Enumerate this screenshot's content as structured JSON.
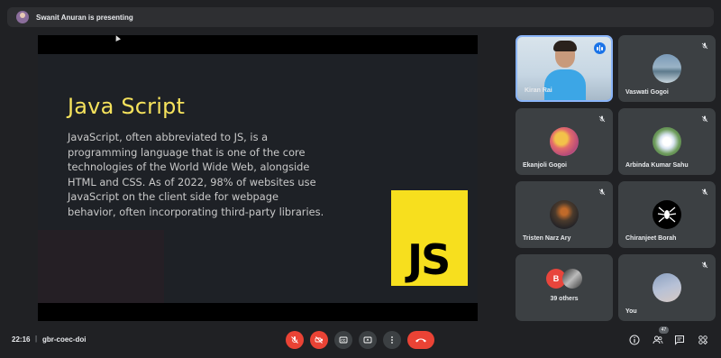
{
  "presenter": {
    "text": "Swanit Anuran is presenting"
  },
  "slide": {
    "title": "Java Script",
    "body": "JavaScript, often abbreviated to JS, is a programming language that is one of the core technologies of the World Wide Web, alongside HTML and CSS. As of 2022, 98% of websites use JavaScript on the client side for webpage behavior, often incorporating third-party libraries.",
    "logo_text": "JS",
    "colors": {
      "title": "#f5e25c",
      "logo_bg": "#f7df1e"
    }
  },
  "participants": [
    {
      "name": "Kiran Rai",
      "type": "video",
      "speaking": true
    },
    {
      "name": "Vaswati Gogoi",
      "type": "avatar",
      "muted": true
    },
    {
      "name": "Ekanjoli Gogoi",
      "type": "avatar",
      "muted": true
    },
    {
      "name": "Arbinda Kumar Sahu",
      "type": "avatar",
      "muted": true
    },
    {
      "name": "Tristen Narz Ary",
      "type": "avatar",
      "muted": true
    },
    {
      "name": "Chiranjeet Borah",
      "type": "avatar",
      "muted": true
    },
    {
      "name": "39 others",
      "type": "group",
      "initial": "B"
    },
    {
      "name": "You",
      "type": "avatar",
      "muted": true
    }
  ],
  "bottom_bar": {
    "time": "22:16",
    "separator": "|",
    "meeting_code": "gbr-coec-doi",
    "people_count": "47",
    "controls": [
      "mic-off-icon",
      "camera-off-icon",
      "captions-icon",
      "present-icon",
      "more-icon",
      "end-call-icon"
    ],
    "right_icons": [
      "info-icon",
      "people-icon",
      "chat-icon",
      "activities-icon"
    ]
  }
}
